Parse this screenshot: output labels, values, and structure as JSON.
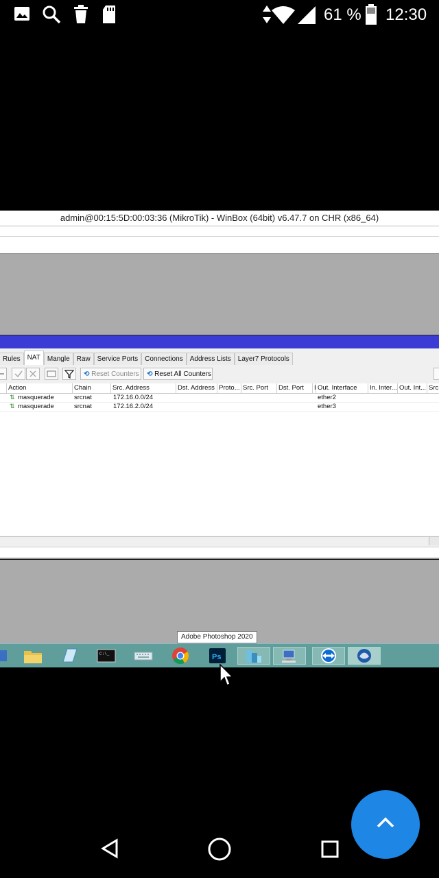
{
  "status_bar": {
    "icons": [
      "image-icon",
      "search-icon",
      "trash-icon",
      "sd-card-icon",
      "data-arrows-icon",
      "wifi-icon",
      "signal-icon",
      "battery-icon"
    ],
    "battery": "61 %",
    "time": "12:30"
  },
  "window": {
    "title": "admin@00:15:5D:00:03:36 (MikroTik) - WinBox (64bit) v6.47.7 on CHR (x86_64)"
  },
  "firewall": {
    "tabs": [
      "Rules",
      "NAT",
      "Mangle",
      "Raw",
      "Service Ports",
      "Connections",
      "Address Lists",
      "Layer7 Protocols"
    ],
    "active_tab": "NAT",
    "buttons": {
      "reset_counters": "Reset Counters",
      "reset_all_counters": "Reset All Counters"
    },
    "columns": [
      "Action",
      "Chain",
      "Src. Address",
      "Dst. Address",
      "Proto...",
      "Src. Port",
      "Dst. Port",
      "I",
      "Out. Interface",
      "In. Inter...",
      "Out. Int...",
      "Src"
    ],
    "rows": [
      {
        "action": "masquerade",
        "chain": "srcnat",
        "src": "172.16.0.0/24",
        "out": "ether2"
      },
      {
        "action": "masquerade",
        "chain": "srcnat",
        "src": "172.16.2.0/24",
        "out": "ether3"
      }
    ]
  },
  "taskbar": {
    "tooltip": "Adobe Photoshop 2020",
    "apps": [
      "app-icon",
      "file-explorer-icon",
      "notepad-icon",
      "cmd-icon",
      "keyboard-icon",
      "chrome-icon",
      "photoshop-icon",
      "buildings-icon",
      "network-computer-icon",
      "teamviewer-icon",
      "winbox-icon"
    ],
    "accent": "#5f9e9a"
  },
  "nav": {
    "icons": [
      "back-icon",
      "home-icon",
      "recents-icon"
    ],
    "fab_icon": "chevron-up-icon",
    "fab_color": "#1e87e6"
  }
}
